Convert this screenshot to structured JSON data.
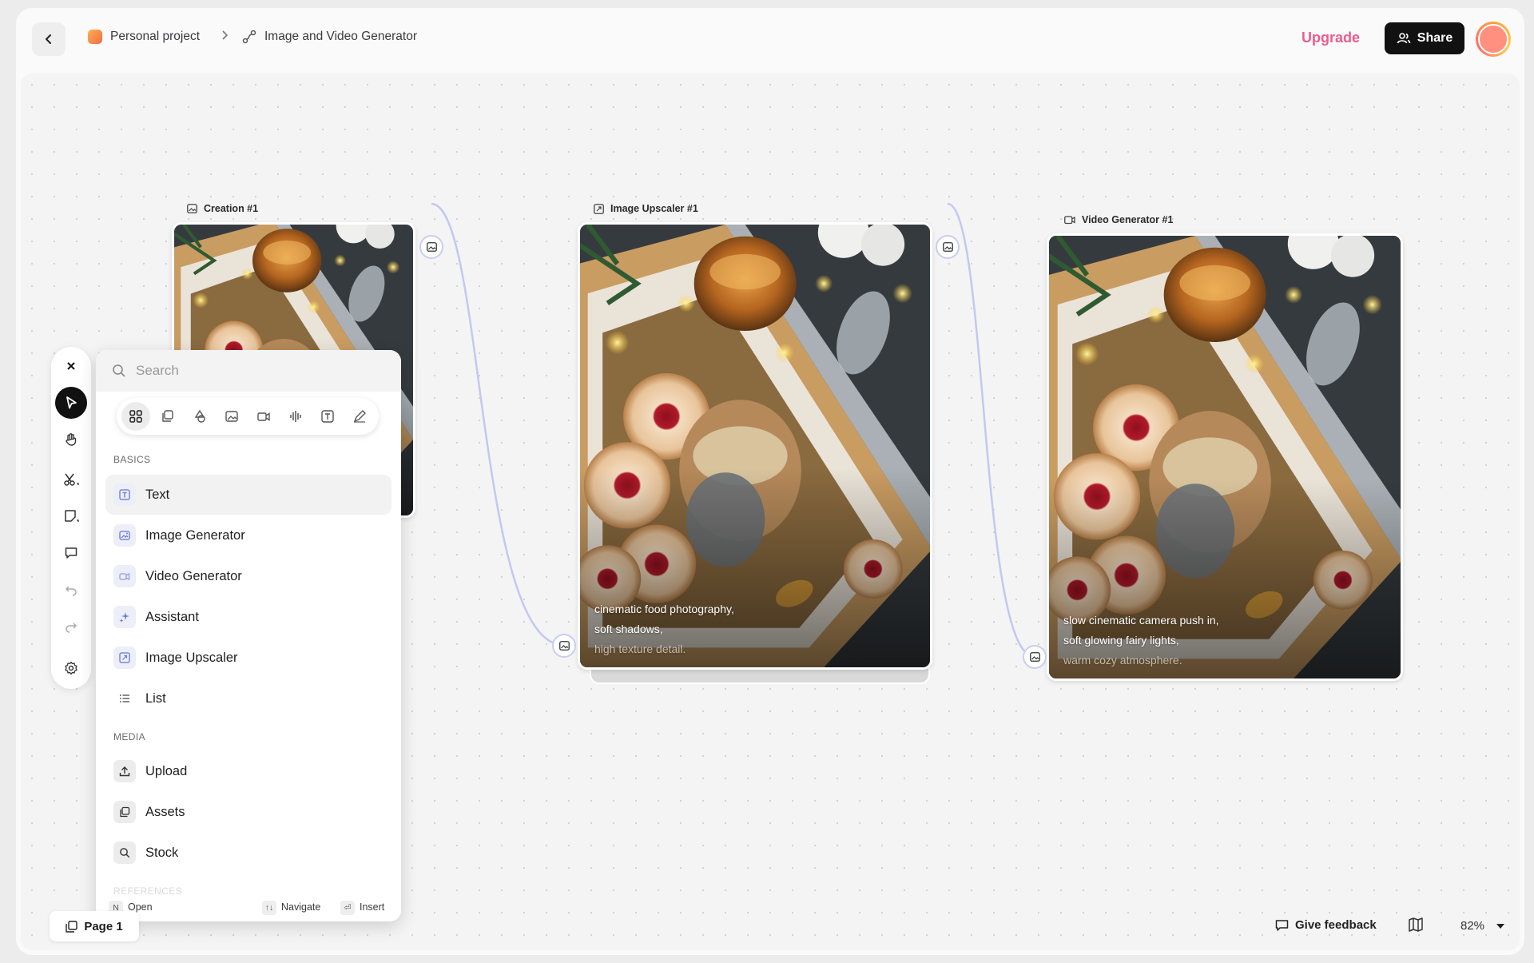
{
  "header": {
    "breadcrumb_project": "Personal project",
    "breadcrumb_flow": "Image and Video Generator",
    "upgrade_label": "Upgrade",
    "share_label": "Share"
  },
  "nodes": {
    "creation": {
      "title": "Creation #1"
    },
    "upscaler": {
      "title": "Image Upscaler #1",
      "caption": [
        "cinematic food photography,",
        "soft shadows,",
        "high texture detail."
      ]
    },
    "video": {
      "title": "Video Generator #1",
      "caption": [
        "slow cinematic camera push in,",
        "soft glowing fairy lights,",
        "warm cozy atmosphere."
      ]
    }
  },
  "palette": {
    "search_placeholder": "Search",
    "filters": [
      "all-icon",
      "assets-icon",
      "shapes-icon",
      "image-icon",
      "video-icon",
      "audio-icon",
      "text-icon",
      "edit-icon"
    ],
    "basics_label": "BASICS",
    "basics": [
      "Text",
      "Image Generator",
      "Video Generator",
      "Assistant",
      "Image Upscaler",
      "List"
    ],
    "media_label": "MEDIA",
    "media": [
      "Upload",
      "Assets",
      "Stock"
    ],
    "references_label": "REFERENCES",
    "footer": {
      "open_key": "N",
      "open_label": "Open",
      "navigate_key": "↑↓",
      "navigate_label": "Navigate",
      "insert_key": "⏎",
      "insert_label": "Insert"
    }
  },
  "toolbar": {
    "tools": [
      "close-icon",
      "pointer-icon",
      "hand-icon",
      "scissors-icon",
      "note-icon",
      "comment-icon",
      "undo-icon",
      "redo-icon",
      "settings-icon"
    ]
  },
  "footer": {
    "page_label": "Page 1",
    "feedback_label": "Give feedback",
    "zoom": "82%"
  },
  "colors": {
    "accent": "#ef5b8c",
    "port_stroke": "#c9cdf1",
    "edge": "#c3c8f0"
  }
}
